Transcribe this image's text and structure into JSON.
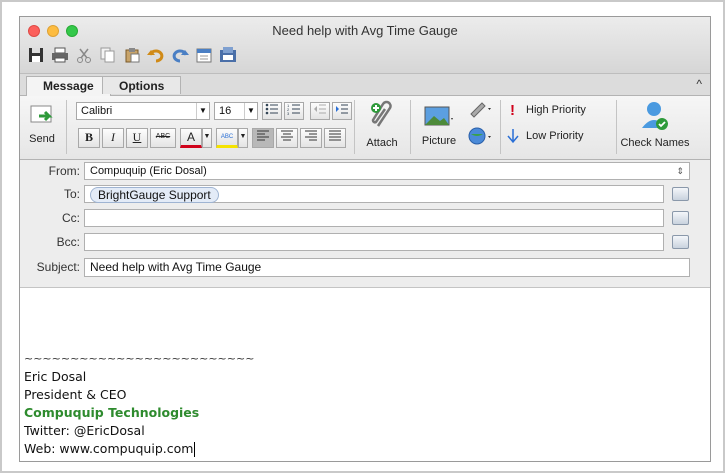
{
  "window": {
    "title": "Need help with Avg Time Gauge"
  },
  "tabs": [
    {
      "label": "Message"
    },
    {
      "label": "Options"
    }
  ],
  "ribbon": {
    "send_label": "Send",
    "font_name": "Calibri",
    "font_size": "16",
    "bold": "B",
    "italic": "I",
    "underline": "U",
    "strike": "ABC",
    "font_color": "A",
    "highlight": "ABC",
    "attach_label": "Attach",
    "picture_label": "Picture",
    "high_priority_label": "High Priority",
    "low_priority_label": "Low Priority",
    "check_names_label": "Check Names"
  },
  "headers": {
    "from_label": "From:",
    "from_value": "Compuquip (Eric Dosal)",
    "to_label": "To:",
    "to_recipient": "BrightGauge Support",
    "cc_label": "Cc:",
    "cc_value": "",
    "bcc_label": "Bcc:",
    "bcc_value": "",
    "subject_label": "Subject:",
    "subject_value": "Need help with Avg Time Gauge"
  },
  "body": {
    "separator": "~~~~~~~~~~~~~~~~~~~~~~~~~",
    "signature_name": "Eric Dosal",
    "signature_title": "President & CEO",
    "signature_company": "Compuquip Technologies",
    "signature_twitter": "Twitter: @EricDosal",
    "signature_web": "Web: www.compuquip.com"
  },
  "colors": {
    "company_green": "#2e8b2e",
    "high_priority_red": "#d0021b",
    "low_priority_blue": "#2a6fd6"
  }
}
